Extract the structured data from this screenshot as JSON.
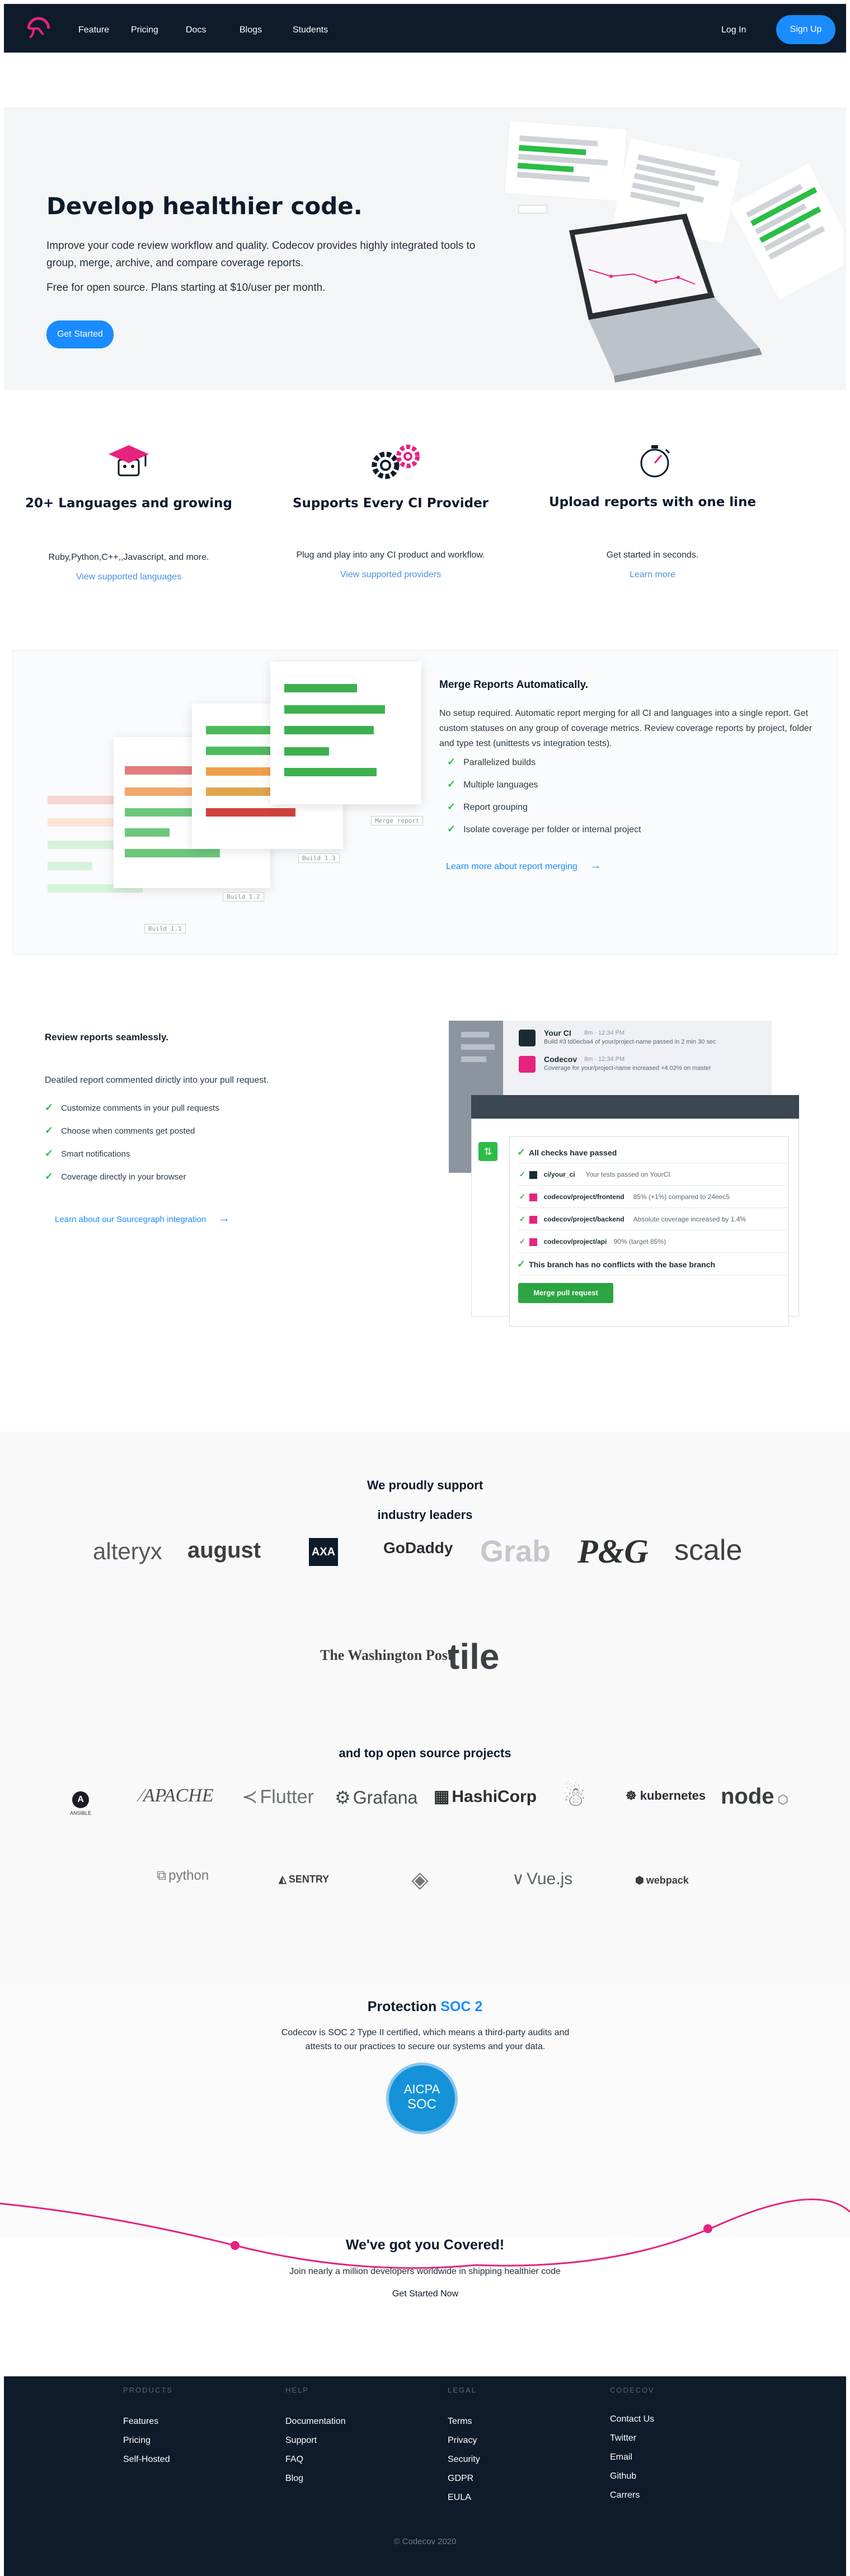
{
  "nav": {
    "links": [
      "Feature",
      "Pricing",
      "Docs",
      "Blogs",
      "Students"
    ],
    "login": "Log In",
    "signup": "Sign Up"
  },
  "hero": {
    "title": "Develop healthier code.",
    "para1": "Improve your code review workflow and quality. Codecov provides highly integrated tools to group, merge, archive, and compare coverage reports.",
    "para2": "Free for open source. Plans starting at $10/user per month.",
    "cta": "Get Started"
  },
  "features": [
    {
      "title": "20+ Languages and growing",
      "desc": "Ruby,Python,C++,,Javascript, and more.",
      "link": "View supported languages"
    },
    {
      "title": "Supports Every CI Provider",
      "desc": "Plug and play into any CI product and workflow.",
      "link": "View supported providers"
    },
    {
      "title": "Upload reports with one line",
      "desc": "Get started in seconds.",
      "link": "Learn more"
    }
  ],
  "merge": {
    "title": "Merge Reports Automatically.",
    "body": "No setup required. Automatic report merging for all CI and languages into a single report. Get custom statuses on any group of coverage metrics. Review coverage reports by project, folder and type test (unittests vs integration tests).",
    "items": [
      "Parallelized builds",
      "Multiple languages",
      "Report grouping",
      "Isolate coverage per folder or internal project"
    ],
    "link": "Learn more about report merging",
    "tags": [
      "Merge report",
      "Build 1.3",
      "Build 1.2",
      "Build 1.1"
    ]
  },
  "review": {
    "title": "Review reports seamlessly.",
    "body": "Deatiled report commented dirictly into your pull request.",
    "items": [
      "Customize comments in your pull requests",
      "Choose when comments get posted",
      "Smart notifications",
      "Coverage directly in your browser"
    ],
    "link": "Learn about our Sourcegraph integration",
    "notifications": [
      {
        "name": "Your CI",
        "time": "8m · 12:34 PM",
        "text": "Build #3 td0ecba4 of your/project-name passed in 2 min 30 sec"
      },
      {
        "name": "Codecov",
        "time": "8m · 12:34 PM",
        "text": "Coverage for your/project-name increased +4.02% on master"
      }
    ],
    "checks_header": "All checks have passed",
    "checks": [
      {
        "name": "ci/your_ci",
        "desc": "Your tests passed on YourCI"
      },
      {
        "name": "codecov/project/frontend",
        "desc": "85% (+1%) compared to 24eec5"
      },
      {
        "name": "codecov/project/backend",
        "desc": "Absolute coverage increased by 1.4%"
      },
      {
        "name": "codecov/project/api",
        "desc": "90% (target 85%)"
      }
    ],
    "no_conflicts": "This branch has no conflicts with the base branch",
    "merge_button": "Merge pull request"
  },
  "logos": {
    "heading1": "We proudly support",
    "heading2": "industry leaders",
    "industry": [
      "alteryx",
      "august",
      "AXA",
      "GoDaddy",
      "Grab",
      "P&G",
      "scale",
      "The Washington Post",
      "tile"
    ],
    "oss_heading": "and top open source projects",
    "oss": [
      "ANSIBLE",
      "APACHE",
      "Flutter",
      "Grafana",
      "HashiCorp",
      "kubernetes",
      "node",
      "python",
      "SENTRY",
      "Vue.js",
      "webpack"
    ]
  },
  "soc": {
    "title_prefix": "Protection ",
    "title_accent": "SOC 2",
    "body": "Codecov is SOC 2 Type II certified, which means a third-party audits and attests to our practices to secure our systems and your data.",
    "badge_top": "AICPA",
    "badge_bottom": "SOC"
  },
  "covered": {
    "title": "We've got you Covered!",
    "body": "Join nearly a million developers worldwide in shipping healthier code",
    "cta": "Get Started Now"
  },
  "footer": {
    "columns": [
      {
        "head": "PRODUCTS",
        "links": [
          "Features",
          "Pricing",
          "Self-Hosted"
        ]
      },
      {
        "head": "HELP",
        "links": [
          "Documentation",
          "Support",
          "FAQ",
          "Blog"
        ]
      },
      {
        "head": "LEGAL",
        "links": [
          "Terms",
          "Privacy",
          "Security",
          "GDPR",
          "EULA"
        ]
      },
      {
        "head": "CODECOV",
        "links": [
          "Contact Us",
          "Twitter",
          "Email",
          "Github",
          "Carrers"
        ]
      }
    ],
    "copyright": "© Codecov 2020"
  },
  "colors": {
    "navy": "#0d1b2a",
    "brand_pink": "#e6237e",
    "blue": "#1a8cff",
    "green": "#2bbd45"
  }
}
